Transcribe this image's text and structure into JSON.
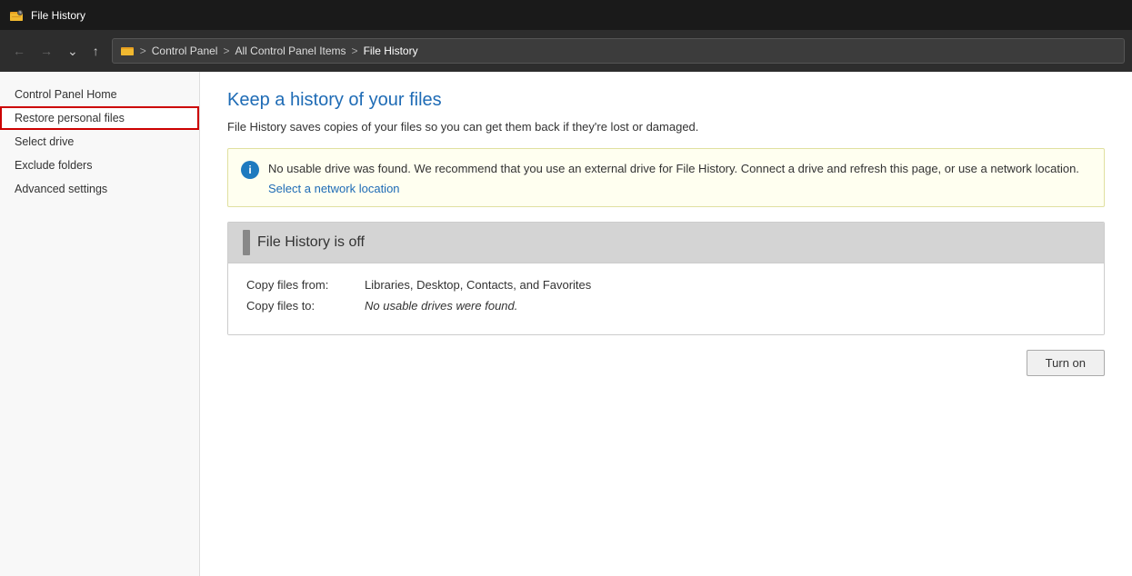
{
  "titlebar": {
    "title": "File History",
    "icon": "folder-clock-icon"
  },
  "navbar": {
    "back_btn": "←",
    "forward_btn": "→",
    "down_btn": "˅",
    "up_btn": "↑",
    "breadcrumb": [
      {
        "label": "Control Panel"
      },
      {
        "label": "All Control Panel Items"
      },
      {
        "label": "File History"
      }
    ]
  },
  "sidebar": {
    "items": [
      {
        "id": "control-panel-home",
        "label": "Control Panel Home",
        "active": false
      },
      {
        "id": "restore-personal-files",
        "label": "Restore personal files",
        "active": true
      },
      {
        "id": "select-drive",
        "label": "Select drive",
        "active": false
      },
      {
        "id": "exclude-folders",
        "label": "Exclude folders",
        "active": false
      },
      {
        "id": "advanced-settings",
        "label": "Advanced settings",
        "active": false
      }
    ]
  },
  "content": {
    "page_title": "Keep a history of your files",
    "page_subtitle": "File History saves copies of your files so you can get them back if they're lost or damaged.",
    "warning": {
      "message": "No usable drive was found. We recommend that you use an external drive for File History. Connect a drive and refresh this page, or use a network location.",
      "link_text": "Select a network location"
    },
    "status_panel": {
      "title": "File History is off",
      "copy_from_label": "Copy files from:",
      "copy_from_value": "Libraries, Desktop, Contacts, and Favorites",
      "copy_to_label": "Copy files to:",
      "copy_to_value": "No usable drives were found."
    },
    "turn_on_button": "Turn on"
  }
}
